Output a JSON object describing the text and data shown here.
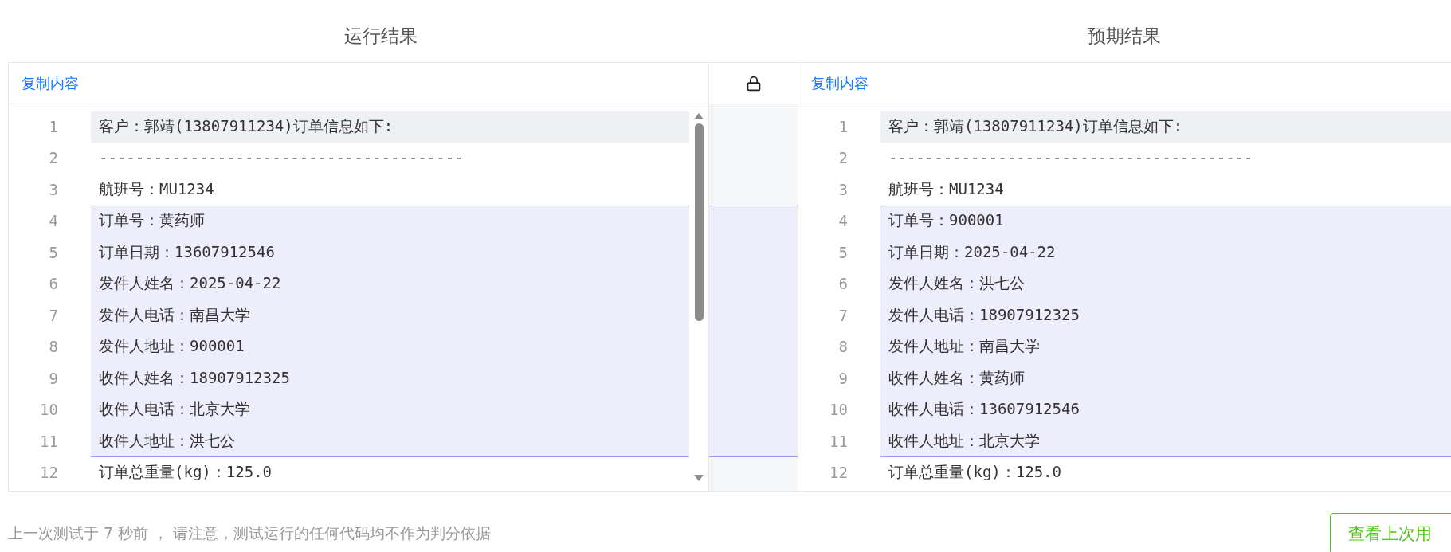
{
  "headings": [
    "运行结果",
    "预期结果"
  ],
  "panels": [
    {
      "copy_label": "复制内容",
      "scrollbar": true,
      "lines": [
        {
          "number": "1",
          "text": "客户：郭靖(13807911234)订单信息如下:",
          "active": true,
          "changed": false
        },
        {
          "number": "2",
          "text": "----------------------------------------",
          "active": false,
          "changed": false
        },
        {
          "number": "3",
          "text": "航班号：MU1234",
          "active": false,
          "changed": false
        },
        {
          "number": "4",
          "text": "订单号：黄药师",
          "active": false,
          "changed": true
        },
        {
          "number": "5",
          "text": "订单日期：13607912546",
          "active": false,
          "changed": true
        },
        {
          "number": "6",
          "text": "发件人姓名：2025-04-22",
          "active": false,
          "changed": true
        },
        {
          "number": "7",
          "text": "发件人电话：南昌大学",
          "active": false,
          "changed": true
        },
        {
          "number": "8",
          "text": "发件人地址：900001",
          "active": false,
          "changed": true
        },
        {
          "number": "9",
          "text": "收件人姓名：18907912325",
          "active": false,
          "changed": true
        },
        {
          "number": "10",
          "text": "收件人电话：北京大学",
          "active": false,
          "changed": true
        },
        {
          "number": "11",
          "text": "收件人地址：洪七公",
          "active": false,
          "changed": true
        },
        {
          "number": "12",
          "text": "订单总重量(kg)：125.0",
          "active": false,
          "changed": false
        }
      ]
    },
    {
      "copy_label": "复制内容",
      "scrollbar": false,
      "lines": [
        {
          "number": "1",
          "text": "客户：郭靖(13807911234)订单信息如下:",
          "active": true,
          "changed": false
        },
        {
          "number": "2",
          "text": "----------------------------------------",
          "active": false,
          "changed": false
        },
        {
          "number": "3",
          "text": "航班号：MU1234",
          "active": false,
          "changed": false
        },
        {
          "number": "4",
          "text": "订单号：900001",
          "active": false,
          "changed": true
        },
        {
          "number": "5",
          "text": "订单日期：2025-04-22",
          "active": false,
          "changed": true
        },
        {
          "number": "6",
          "text": "发件人姓名：洪七公",
          "active": false,
          "changed": true
        },
        {
          "number": "7",
          "text": "发件人电话：18907912325",
          "active": false,
          "changed": true
        },
        {
          "number": "8",
          "text": "发件人地址：南昌大学",
          "active": false,
          "changed": true
        },
        {
          "number": "9",
          "text": "收件人姓名：黄药师",
          "active": false,
          "changed": true
        },
        {
          "number": "10",
          "text": "收件人电话：13607912546",
          "active": false,
          "changed": true
        },
        {
          "number": "11",
          "text": "收件人地址：北京大学",
          "active": false,
          "changed": true
        },
        {
          "number": "12",
          "text": "订单总重量(kg)：125.0",
          "active": false,
          "changed": false
        }
      ]
    }
  ],
  "footer": {
    "note": "上一次测试于 7 秒前 ， 请注意，测试运行的任何代码均不作为判分依据",
    "button": "查看上次用"
  }
}
